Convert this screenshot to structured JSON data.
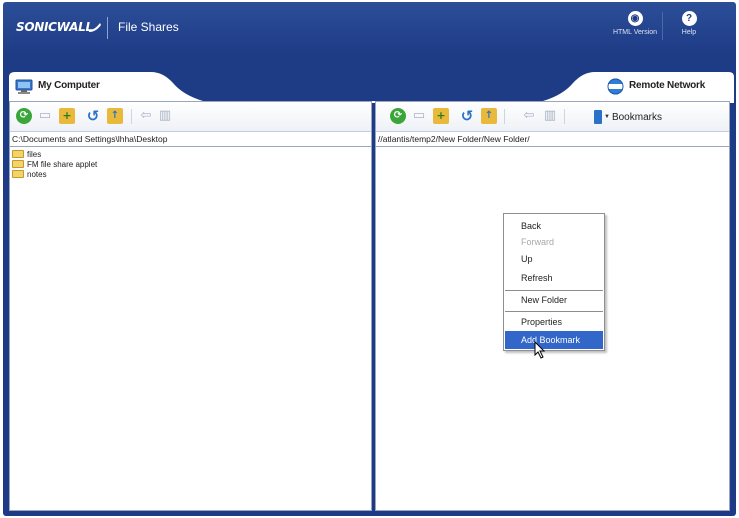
{
  "header": {
    "logo_text": "SONICWALL",
    "title": "File Shares",
    "buttons": [
      {
        "label": "HTML Version",
        "icon": "eye-icon"
      },
      {
        "label": "Help",
        "icon": "help-icon"
      }
    ]
  },
  "left_pane": {
    "tab_label": "My Computer",
    "path": "C:\\Documents and Settings\\lhha\\Desktop",
    "files": [
      {
        "name": "files",
        "type": "folder"
      },
      {
        "name": "FM file share applet",
        "type": "folder"
      },
      {
        "name": "notes",
        "type": "folder"
      }
    ]
  },
  "right_pane": {
    "tab_label": "Remote Network",
    "path": "//atlantis/temp2/New Folder/New Folder/",
    "bookmarks_label": "Bookmarks"
  },
  "context_menu": {
    "items": [
      {
        "label": "Back",
        "enabled": true
      },
      {
        "label": "Forward",
        "enabled": false
      },
      {
        "label": "Up",
        "enabled": true
      },
      {
        "label": "Refresh",
        "enabled": true
      },
      {
        "label": "New Folder",
        "enabled": true
      },
      {
        "label": "Properties",
        "enabled": true
      },
      {
        "label": "Add Bookmark",
        "enabled": true,
        "highlighted": true
      }
    ]
  },
  "colors": {
    "header_bg": "#1e3b86",
    "menu_highlight": "#3266c8",
    "folder": "#f3d36b"
  }
}
